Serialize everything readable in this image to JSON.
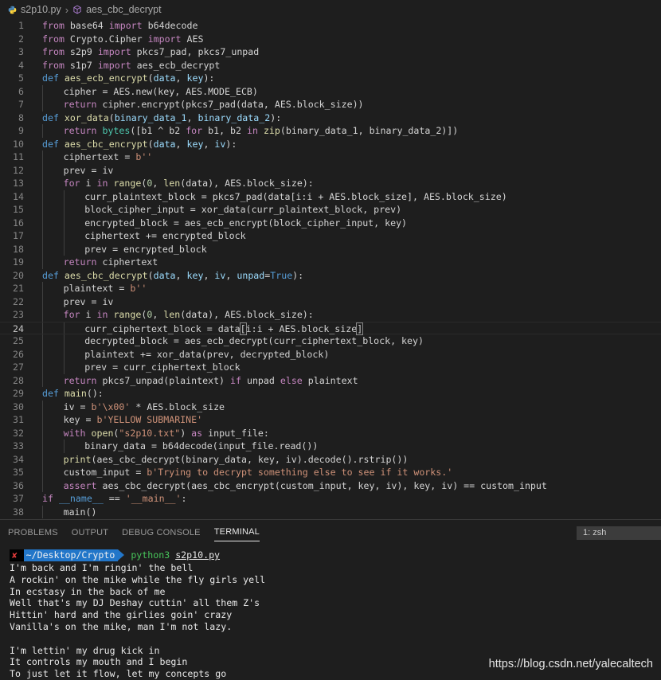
{
  "breadcrumb": {
    "file": "s2p10.py",
    "symbol": "aes_cbc_decrypt"
  },
  "editor": {
    "active_line": 24,
    "lines": [
      {
        "n": "1",
        "indent": 0,
        "tokens": [
          [
            "kw",
            "from"
          ],
          [
            "tx",
            " base64 "
          ],
          [
            "kw",
            "import"
          ],
          [
            "tx",
            " b64decode"
          ]
        ]
      },
      {
        "n": "2",
        "indent": 0,
        "tokens": [
          [
            "kw",
            "from"
          ],
          [
            "tx",
            " Crypto.Cipher "
          ],
          [
            "kw",
            "import"
          ],
          [
            "tx",
            " AES"
          ]
        ]
      },
      {
        "n": "3",
        "indent": 0,
        "tokens": [
          [
            "kw",
            "from"
          ],
          [
            "tx",
            " s2p9 "
          ],
          [
            "kw",
            "import"
          ],
          [
            "tx",
            " pkcs7_pad, pkcs7_unpad"
          ]
        ]
      },
      {
        "n": "4",
        "indent": 0,
        "tokens": [
          [
            "kw",
            "from"
          ],
          [
            "tx",
            " s1p7 "
          ],
          [
            "kw",
            "import"
          ],
          [
            "tx",
            " aes_ecb_decrypt"
          ]
        ]
      },
      {
        "n": "5",
        "indent": 0,
        "tokens": [
          [
            "df",
            "def "
          ],
          [
            "fn",
            "aes_ecb_encrypt"
          ],
          [
            "tx",
            "("
          ],
          [
            "pa",
            "data"
          ],
          [
            "tx",
            ", "
          ],
          [
            "pa",
            "key"
          ],
          [
            "tx",
            "):"
          ]
        ]
      },
      {
        "n": "6",
        "indent": 1,
        "tokens": [
          [
            "tx",
            "cipher = AES.new(key, AES.MODE_ECB)"
          ]
        ]
      },
      {
        "n": "7",
        "indent": 1,
        "tokens": [
          [
            "kw",
            "return"
          ],
          [
            "tx",
            " cipher.encrypt(pkcs7_pad(data, AES.block_size))"
          ]
        ]
      },
      {
        "n": "8",
        "indent": 0,
        "tokens": [
          [
            "df",
            "def "
          ],
          [
            "fn",
            "xor_data"
          ],
          [
            "tx",
            "("
          ],
          [
            "pa",
            "binary_data_1"
          ],
          [
            "tx",
            ", "
          ],
          [
            "pa",
            "binary_data_2"
          ],
          [
            "tx",
            "):"
          ]
        ]
      },
      {
        "n": "9",
        "indent": 1,
        "tokens": [
          [
            "kw",
            "return"
          ],
          [
            "tx",
            " "
          ],
          [
            "bi",
            "bytes"
          ],
          [
            "tx",
            "([b1 ^ b2 "
          ],
          [
            "kw",
            "for"
          ],
          [
            "tx",
            " b1, b2 "
          ],
          [
            "kw",
            "in"
          ],
          [
            "tx",
            " "
          ],
          [
            "fn",
            "zip"
          ],
          [
            "tx",
            "(binary_data_1, binary_data_2)])"
          ]
        ]
      },
      {
        "n": "10",
        "indent": 0,
        "tokens": [
          [
            "df",
            "def "
          ],
          [
            "fn",
            "aes_cbc_encrypt"
          ],
          [
            "tx",
            "("
          ],
          [
            "pa",
            "data"
          ],
          [
            "tx",
            ", "
          ],
          [
            "pa",
            "key"
          ],
          [
            "tx",
            ", "
          ],
          [
            "pa",
            "iv"
          ],
          [
            "tx",
            "):"
          ]
        ]
      },
      {
        "n": "11",
        "indent": 1,
        "tokens": [
          [
            "tx",
            "ciphertext = "
          ],
          [
            "st",
            "b''"
          ]
        ]
      },
      {
        "n": "12",
        "indent": 1,
        "tokens": [
          [
            "tx",
            "prev = iv"
          ]
        ]
      },
      {
        "n": "13",
        "indent": 1,
        "tokens": [
          [
            "kw",
            "for"
          ],
          [
            "tx",
            " i "
          ],
          [
            "kw",
            "in"
          ],
          [
            "tx",
            " "
          ],
          [
            "fn",
            "range"
          ],
          [
            "tx",
            "("
          ],
          [
            "nm",
            "0"
          ],
          [
            "tx",
            ", "
          ],
          [
            "fn",
            "len"
          ],
          [
            "tx",
            "(data), AES.block_size):"
          ]
        ]
      },
      {
        "n": "14",
        "indent": 2,
        "tokens": [
          [
            "tx",
            "curr_plaintext_block = pkcs7_pad(data[i:i + AES.block_size], AES.block_size)"
          ]
        ]
      },
      {
        "n": "15",
        "indent": 2,
        "tokens": [
          [
            "tx",
            "block_cipher_input = xor_data(curr_plaintext_block, prev)"
          ]
        ]
      },
      {
        "n": "16",
        "indent": 2,
        "tokens": [
          [
            "tx",
            "encrypted_block = aes_ecb_encrypt(block_cipher_input, key)"
          ]
        ]
      },
      {
        "n": "17",
        "indent": 2,
        "tokens": [
          [
            "tx",
            "ciphertext += encrypted_block"
          ]
        ]
      },
      {
        "n": "18",
        "indent": 2,
        "tokens": [
          [
            "tx",
            "prev = encrypted_block"
          ]
        ]
      },
      {
        "n": "19",
        "indent": 1,
        "tokens": [
          [
            "kw",
            "return"
          ],
          [
            "tx",
            " ciphertext"
          ]
        ]
      },
      {
        "n": "20",
        "indent": 0,
        "tokens": [
          [
            "df",
            "def "
          ],
          [
            "fn",
            "aes_cbc_decrypt"
          ],
          [
            "tx",
            "("
          ],
          [
            "pa",
            "data"
          ],
          [
            "tx",
            ", "
          ],
          [
            "pa",
            "key"
          ],
          [
            "tx",
            ", "
          ],
          [
            "pa",
            "iv"
          ],
          [
            "tx",
            ", "
          ],
          [
            "pa",
            "unpad"
          ],
          [
            "tx",
            "="
          ],
          [
            "cn",
            "True"
          ],
          [
            "tx",
            "):"
          ]
        ]
      },
      {
        "n": "21",
        "indent": 1,
        "tokens": [
          [
            "tx",
            "plaintext = "
          ],
          [
            "st",
            "b''"
          ]
        ]
      },
      {
        "n": "22",
        "indent": 1,
        "tokens": [
          [
            "tx",
            "prev = iv"
          ]
        ]
      },
      {
        "n": "23",
        "indent": 1,
        "tokens": [
          [
            "kw",
            "for"
          ],
          [
            "tx",
            " i "
          ],
          [
            "kw",
            "in"
          ],
          [
            "tx",
            " "
          ],
          [
            "fn",
            "range"
          ],
          [
            "tx",
            "("
          ],
          [
            "nm",
            "0"
          ],
          [
            "tx",
            ", "
          ],
          [
            "fn",
            "len"
          ],
          [
            "tx",
            "(data), AES.block_size):"
          ]
        ]
      },
      {
        "n": "24",
        "indent": 2,
        "tokens": [
          [
            "tx",
            "curr_ciphertext_block = data"
          ],
          [
            "bkt",
            "["
          ],
          [
            "tx",
            "i:i + AES.block_size"
          ],
          [
            "bkt",
            "]"
          ]
        ]
      },
      {
        "n": "25",
        "indent": 2,
        "tokens": [
          [
            "tx",
            "decrypted_block = aes_ecb_decrypt(curr_ciphertext_block, key)"
          ]
        ]
      },
      {
        "n": "26",
        "indent": 2,
        "tokens": [
          [
            "tx",
            "plaintext += xor_data(prev, decrypted_block)"
          ]
        ]
      },
      {
        "n": "27",
        "indent": 2,
        "tokens": [
          [
            "tx",
            "prev = curr_ciphertext_block"
          ]
        ]
      },
      {
        "n": "28",
        "indent": 1,
        "tokens": [
          [
            "kw",
            "return"
          ],
          [
            "tx",
            " pkcs7_unpad(plaintext) "
          ],
          [
            "kw",
            "if"
          ],
          [
            "tx",
            " unpad "
          ],
          [
            "kw",
            "else"
          ],
          [
            "tx",
            " plaintext"
          ]
        ]
      },
      {
        "n": "29",
        "indent": 0,
        "tokens": [
          [
            "df",
            "def "
          ],
          [
            "fn",
            "main"
          ],
          [
            "tx",
            "():"
          ]
        ]
      },
      {
        "n": "30",
        "indent": 1,
        "tokens": [
          [
            "tx",
            "iv = "
          ],
          [
            "st",
            "b'\\x00'"
          ],
          [
            "tx",
            " * AES.block_size"
          ]
        ]
      },
      {
        "n": "31",
        "indent": 1,
        "tokens": [
          [
            "tx",
            "key = "
          ],
          [
            "st",
            "b'YELLOW SUBMARINE'"
          ]
        ]
      },
      {
        "n": "32",
        "indent": 1,
        "tokens": [
          [
            "kw",
            "with"
          ],
          [
            "tx",
            " "
          ],
          [
            "fn",
            "open"
          ],
          [
            "tx",
            "("
          ],
          [
            "st",
            "\"s2p10.txt\""
          ],
          [
            "tx",
            ") "
          ],
          [
            "kw",
            "as"
          ],
          [
            "tx",
            " input_file:"
          ]
        ]
      },
      {
        "n": "33",
        "indent": 2,
        "tokens": [
          [
            "tx",
            "binary_data = b64decode(input_file.read())"
          ]
        ]
      },
      {
        "n": "34",
        "indent": 1,
        "tokens": [
          [
            "fn",
            "print"
          ],
          [
            "tx",
            "(aes_cbc_decrypt(binary_data, key, iv).decode().rstrip())"
          ]
        ]
      },
      {
        "n": "35",
        "indent": 1,
        "tokens": [
          [
            "tx",
            "custom_input = "
          ],
          [
            "st",
            "b'Trying to decrypt something else to see if it works.'"
          ]
        ]
      },
      {
        "n": "36",
        "indent": 1,
        "tokens": [
          [
            "kw",
            "assert"
          ],
          [
            "tx",
            " aes_cbc_decrypt(aes_cbc_encrypt(custom_input, key, iv), key, iv) == custom_input"
          ]
        ]
      },
      {
        "n": "37",
        "indent": 0,
        "tokens": [
          [
            "kw",
            "if"
          ],
          [
            "tx",
            " "
          ],
          [
            "df",
            "__name__"
          ],
          [
            "tx",
            " == "
          ],
          [
            "st",
            "'__main__'"
          ],
          [
            "tx",
            ":"
          ]
        ]
      },
      {
        "n": "38",
        "indent": 1,
        "tokens": [
          [
            "tx",
            "main()"
          ]
        ]
      }
    ]
  },
  "panel": {
    "tabs": [
      "PROBLEMS",
      "OUTPUT",
      "DEBUG CONSOLE",
      "TERMINAL"
    ],
    "active_tab": "TERMINAL",
    "terminal_select": "1: zsh"
  },
  "terminal": {
    "prompt_status": "✘",
    "prompt_dir": "~/Desktop/Crypto",
    "command": "python3",
    "command_arg": "s2p10.py",
    "output": [
      "I'm back and I'm ringin' the bell",
      "A rockin' on the mike while the fly girls yell",
      "In ecstasy in the back of me",
      "Well that's my DJ Deshay cuttin' all them Z's",
      "Hittin' hard and the girlies goin' crazy",
      "Vanilla's on the mike, man I'm not lazy.",
      "",
      "I'm lettin' my drug kick in",
      "It controls my mouth and I begin",
      "To just let it flow, let my concepts go"
    ]
  },
  "watermark": "https://blog.csdn.net/yalecaltech",
  "colors": {
    "background": "#1e1e1e",
    "keyword": "#c586c0",
    "def": "#569cd6",
    "function": "#dcdcaa",
    "param": "#9cdcfe",
    "string": "#ce9178",
    "number": "#b5cea8",
    "builtin_type": "#4ec9b0",
    "prompt_dir_bg": "#2276c9",
    "prompt_cmd": "#47c45a"
  }
}
